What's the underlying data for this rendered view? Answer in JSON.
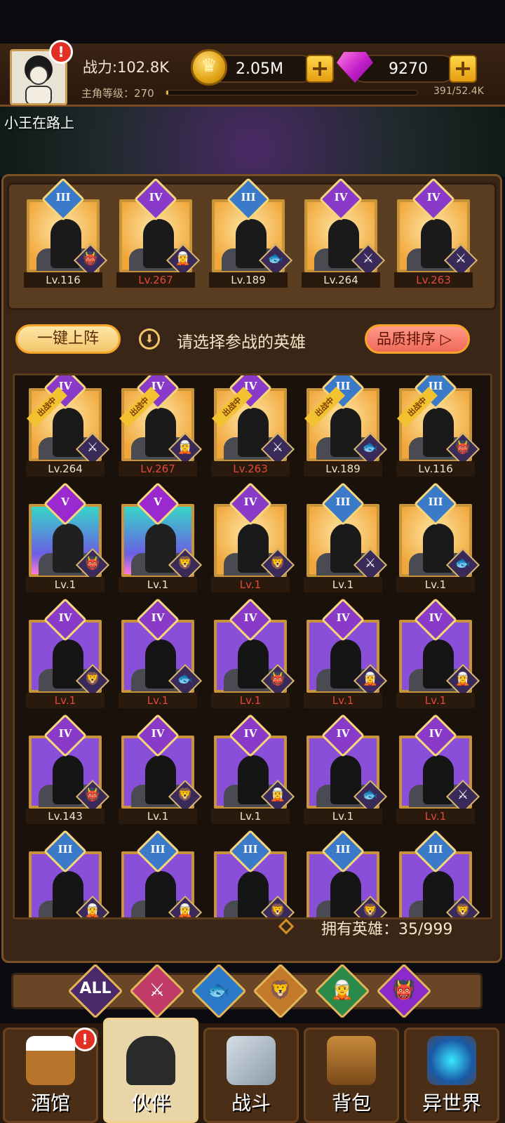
{
  "player": {
    "power": "战力:102.8K",
    "level_label": "主角等级：270",
    "level_progress_text": "391/52.4K",
    "level_progress_fraction": 0.0075,
    "name": "小王在路上"
  },
  "currency": {
    "coins": "2.05M",
    "gems": "9270",
    "plus": "+"
  },
  "alert": "!",
  "team": [
    {
      "rank": "III",
      "level": "Lv.116",
      "level_color": "white",
      "card": "gold",
      "faction": "demon"
    },
    {
      "rank": "IV",
      "level": "Lv.267",
      "level_color": "red",
      "card": "gold",
      "faction": "elf"
    },
    {
      "rank": "III",
      "level": "Lv.189",
      "level_color": "white",
      "card": "gold",
      "faction": "fish"
    },
    {
      "rank": "IV",
      "level": "Lv.264",
      "level_color": "white",
      "card": "gold",
      "faction": "human"
    },
    {
      "rank": "IV",
      "level": "Lv.263",
      "level_color": "red",
      "card": "gold",
      "faction": "human"
    }
  ],
  "actions": {
    "one_click": "一键上阵",
    "hint": "请选择参战的英雄",
    "sort": "品质排序",
    "sort_arrow": "▷"
  },
  "in_battle_ribbon": "出战中",
  "heroes": [
    {
      "rank": "IV",
      "level": "Lv.264",
      "level_color": "white",
      "card": "gold",
      "faction": "human",
      "in_battle": true
    },
    {
      "rank": "IV",
      "level": "Lv.267",
      "level_color": "red",
      "card": "gold",
      "faction": "elf",
      "in_battle": true
    },
    {
      "rank": "IV",
      "level": "Lv.263",
      "level_color": "red",
      "card": "gold",
      "faction": "human",
      "in_battle": true
    },
    {
      "rank": "III",
      "level": "Lv.189",
      "level_color": "white",
      "card": "gold",
      "faction": "fish",
      "in_battle": true
    },
    {
      "rank": "III",
      "level": "Lv.116",
      "level_color": "white",
      "card": "gold",
      "faction": "demon",
      "in_battle": true
    },
    {
      "rank": "V",
      "level": "Lv.1",
      "level_color": "white",
      "card": "teal",
      "faction": "demon",
      "in_battle": false
    },
    {
      "rank": "V",
      "level": "Lv.1",
      "level_color": "white",
      "card": "teal",
      "faction": "beast",
      "in_battle": false
    },
    {
      "rank": "IV",
      "level": "Lv.1",
      "level_color": "red",
      "card": "gold",
      "faction": "beast",
      "in_battle": false
    },
    {
      "rank": "III",
      "level": "Lv.1",
      "level_color": "white",
      "card": "gold",
      "faction": "human",
      "in_battle": false
    },
    {
      "rank": "III",
      "level": "Lv.1",
      "level_color": "white",
      "card": "gold",
      "faction": "fish",
      "in_battle": false
    },
    {
      "rank": "IV",
      "level": "Lv.1",
      "level_color": "red",
      "card": "purple",
      "faction": "beast",
      "in_battle": false
    },
    {
      "rank": "IV",
      "level": "Lv.1",
      "level_color": "red",
      "card": "purple",
      "faction": "fish",
      "in_battle": false
    },
    {
      "rank": "IV",
      "level": "Lv.1",
      "level_color": "red",
      "card": "purple",
      "faction": "demon",
      "in_battle": false
    },
    {
      "rank": "IV",
      "level": "Lv.1",
      "level_color": "red",
      "card": "purple",
      "faction": "elf",
      "in_battle": false
    },
    {
      "rank": "IV",
      "level": "Lv.1",
      "level_color": "red",
      "card": "purple",
      "faction": "elf",
      "in_battle": false
    },
    {
      "rank": "IV",
      "level": "Lv.143",
      "level_color": "white",
      "card": "purple",
      "faction": "demon",
      "in_battle": false
    },
    {
      "rank": "IV",
      "level": "Lv.1",
      "level_color": "white",
      "card": "purple",
      "faction": "beast",
      "in_battle": false
    },
    {
      "rank": "IV",
      "level": "Lv.1",
      "level_color": "white",
      "card": "purple",
      "faction": "elf",
      "in_battle": false
    },
    {
      "rank": "IV",
      "level": "Lv.1",
      "level_color": "white",
      "card": "purple",
      "faction": "fish",
      "in_battle": false
    },
    {
      "rank": "IV",
      "level": "Lv.1",
      "level_color": "red",
      "card": "purple",
      "faction": "human",
      "in_battle": false
    },
    {
      "rank": "III",
      "level": "",
      "level_color": "white",
      "card": "purple",
      "faction": "elf",
      "in_battle": false
    },
    {
      "rank": "III",
      "level": "",
      "level_color": "white",
      "card": "purple",
      "faction": "elf",
      "in_battle": false
    },
    {
      "rank": "III",
      "level": "",
      "level_color": "white",
      "card": "purple",
      "faction": "beast",
      "in_battle": false
    },
    {
      "rank": "III",
      "level": "",
      "level_color": "white",
      "card": "purple",
      "faction": "beast",
      "in_battle": false
    },
    {
      "rank": "III",
      "level": "",
      "level_color": "white",
      "card": "purple",
      "faction": "beast",
      "in_battle": false
    }
  ],
  "owned": "拥有英雄：35/999",
  "filters": [
    {
      "label": "ALL",
      "icon": "all-icon",
      "color": "#4a2a6a"
    },
    {
      "label": "",
      "icon": "human-faction-icon",
      "color": "#c23a6a"
    },
    {
      "label": "",
      "icon": "fish-faction-icon",
      "color": "#2a7ac8"
    },
    {
      "label": "",
      "icon": "beast-faction-icon",
      "color": "#c27a2a"
    },
    {
      "label": "",
      "icon": "elf-faction-icon",
      "color": "#2a8a4a"
    },
    {
      "label": "",
      "icon": "demon-faction-icon",
      "color": "#8a2ac8"
    }
  ],
  "nav": [
    {
      "label": "酒馆",
      "icon": "tavern-mug-icon",
      "alert": true
    },
    {
      "label": "伙伴",
      "icon": "partner-icon",
      "alert": false,
      "active": true
    },
    {
      "label": "战斗",
      "icon": "battle-swords-icon",
      "alert": false
    },
    {
      "label": "背包",
      "icon": "backpack-chest-icon",
      "alert": false
    },
    {
      "label": "异世界",
      "icon": "otherworld-portal-icon",
      "alert": false
    }
  ]
}
